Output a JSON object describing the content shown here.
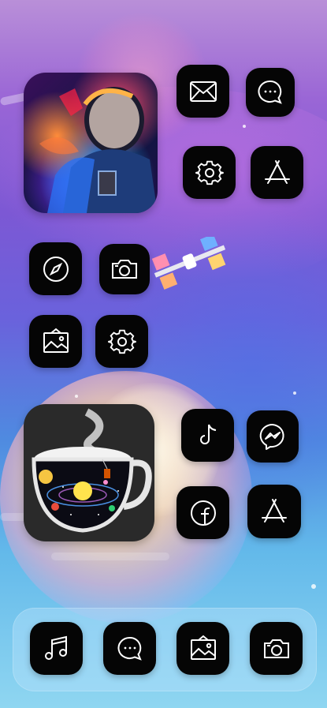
{
  "widgets": {
    "astronaut": {
      "icon": "astronaut-photo-icon"
    },
    "cosmic_cup": {
      "icon": "cosmic-teacup-icon"
    }
  },
  "apps": [
    {
      "id": "mail",
      "icon": "envelope-icon"
    },
    {
      "id": "messages",
      "icon": "chat-bubble-icon"
    },
    {
      "id": "settings",
      "icon": "gear-icon"
    },
    {
      "id": "app-store",
      "icon": "app-store-icon"
    },
    {
      "id": "safari",
      "icon": "compass-icon"
    },
    {
      "id": "camera",
      "icon": "camera-icon"
    },
    {
      "id": "photos",
      "icon": "photo-frame-icon"
    },
    {
      "id": "settings-2",
      "icon": "gear-icon"
    },
    {
      "id": "tiktok",
      "icon": "tiktok-icon"
    },
    {
      "id": "messenger",
      "icon": "messenger-icon"
    },
    {
      "id": "facebook",
      "icon": "facebook-icon"
    },
    {
      "id": "app-store-2",
      "icon": "app-store-icon"
    }
  ],
  "dock": [
    {
      "id": "music",
      "icon": "music-note-icon"
    },
    {
      "id": "messages",
      "icon": "chat-bubble-icon"
    },
    {
      "id": "photos",
      "icon": "photo-frame-icon"
    },
    {
      "id": "camera",
      "icon": "camera-icon"
    }
  ],
  "colors": {
    "icon_bg": "#050505",
    "icon_stroke": "#ffffff",
    "wallpaper_top": "#b98fd8",
    "wallpaper_bottom": "#8fd6f1"
  }
}
